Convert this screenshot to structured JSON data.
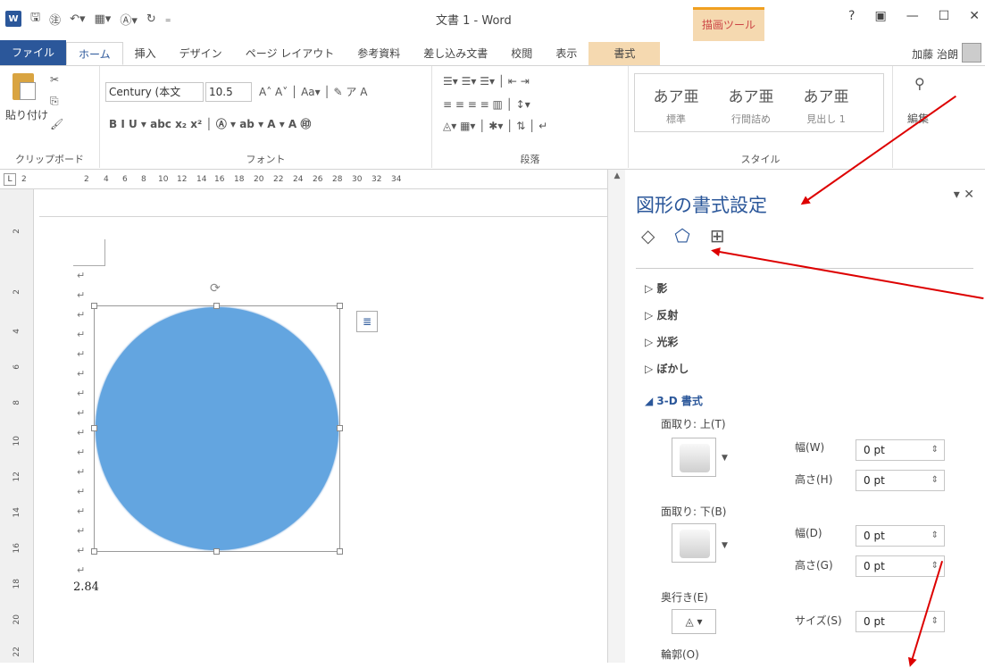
{
  "title": "文書 1 - Word",
  "draw_tools": "描画ツール",
  "tabs": [
    "ファイル",
    "ホーム",
    "挿入",
    "デザイン",
    "ページ レイアウト",
    "参考資料",
    "差し込み文書",
    "校閲",
    "表示",
    "書式"
  ],
  "user": "加藤 治朗",
  "ribbon": {
    "clipboard": {
      "paste": "貼り付け",
      "label": "クリップボード"
    },
    "font": {
      "name": "Century (本文",
      "size": "10.5",
      "label": "フォント"
    },
    "paragraph": {
      "label": "段落"
    },
    "styles": {
      "items": [
        {
          "preview": "あア亜",
          "name": "標準"
        },
        {
          "preview": "あア亜",
          "name": "行間詰め"
        },
        {
          "preview": "あア亜",
          "name": "見出し 1"
        }
      ],
      "label": "スタイル"
    },
    "edit": {
      "label": "編集"
    }
  },
  "ruler": [
    "2",
    "2",
    "4",
    "6",
    "8",
    "10",
    "12",
    "14",
    "16",
    "18",
    "20",
    "22",
    "24",
    "26",
    "28",
    "30",
    "32",
    "34"
  ],
  "vruler": [
    "2",
    "2",
    "4",
    "6",
    "8",
    "10",
    "12",
    "14",
    "16",
    "18",
    "20",
    "22"
  ],
  "document": {
    "value": "2.84"
  },
  "pane": {
    "title": "図形の書式設定",
    "sections": [
      {
        "label": "影"
      },
      {
        "label": "反射"
      },
      {
        "label": "光彩"
      },
      {
        "label": "ぼかし"
      },
      {
        "label": "3-D 書式"
      }
    ],
    "bevel_top": "面取り: 上(T)",
    "bevel_bottom": "面取り: 下(B)",
    "width_w": "幅(W)",
    "height_h": "高さ(H)",
    "width_d": "幅(D)",
    "height_g": "高さ(G)",
    "depth": "奥行き(E)",
    "size": "サイズ(S)",
    "contour": "輪郭(O)",
    "values": {
      "w": "0 pt",
      "h": "0 pt",
      "d": "0 pt",
      "g": "0 pt",
      "s": "0 pt"
    }
  }
}
